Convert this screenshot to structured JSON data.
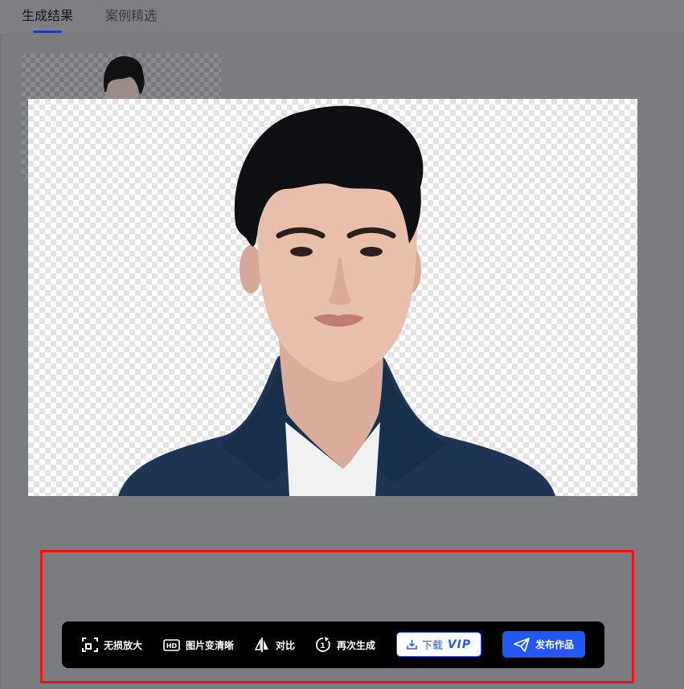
{
  "tabs": {
    "active": "生成结果",
    "inactive": "案例精选"
  },
  "toolbar": {
    "lossless_upscale": "无损放大",
    "hd_enhance": "图片变清晰",
    "hd_badge": "HD",
    "compare": "对比",
    "regenerate": "再次生成",
    "regenerate_badge": "1",
    "download": "下载",
    "vip_badge": "VIP",
    "publish": "发布作品"
  },
  "icons": {
    "lossless_upscale": "expand-frame-icon",
    "hd_enhance": "hd-icon",
    "compare": "compare-split-icon",
    "regenerate": "regenerate-icon",
    "download": "download-icon",
    "publish": "paper-plane-icon"
  },
  "colors": {
    "accent": "#2357f5",
    "highlight_box": "#f11313",
    "toolbar_bg": "#000000",
    "overlay_bg": "#7b7c80"
  }
}
